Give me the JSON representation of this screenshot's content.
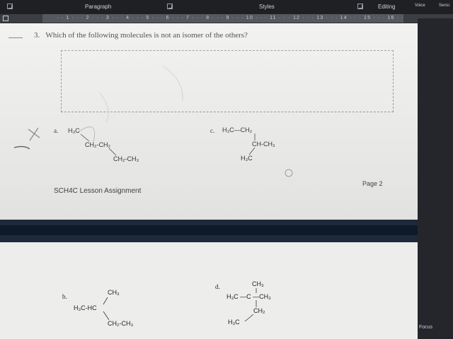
{
  "ribbon": {
    "groups": [
      "Paragraph",
      "Styles",
      "Editing",
      "Voice",
      "Sensi"
    ]
  },
  "ruler": {
    "ticks": "· · 1 · · · 2 · · · 3 · · · 4 · · · 5 · · · 6 · · · 7 · · · 8 · · · 9 · · · 10 · · · 11 · · · 12 · · · 13 · · · 14 · · · 15 · · · 16 · ·"
  },
  "document": {
    "question_number": "3.",
    "question_text": "Which of the following molecules is not an isomer of the others?",
    "options": {
      "a": {
        "label": "a.",
        "lines": [
          "H₃C",
          "CH₂-CH₂",
          "CH₂-CH₃"
        ]
      },
      "b": {
        "label": "b.",
        "lines": [
          "CH₃",
          "H₃C-HC",
          "CH₂-CH₃"
        ]
      },
      "c": {
        "label": "c.",
        "lines": [
          "H₃C—CH₂",
          "CH-CH₃",
          "H₃C"
        ]
      },
      "d": {
        "label": "d.",
        "lines": [
          "CH₃",
          "H₃C —C —CH₃",
          "CH₂",
          "H₃C"
        ]
      }
    },
    "footer_left": "SCH4C Lesson Assignment",
    "footer_right": "Page 2"
  },
  "status": {
    "focus_label": "Focus"
  }
}
